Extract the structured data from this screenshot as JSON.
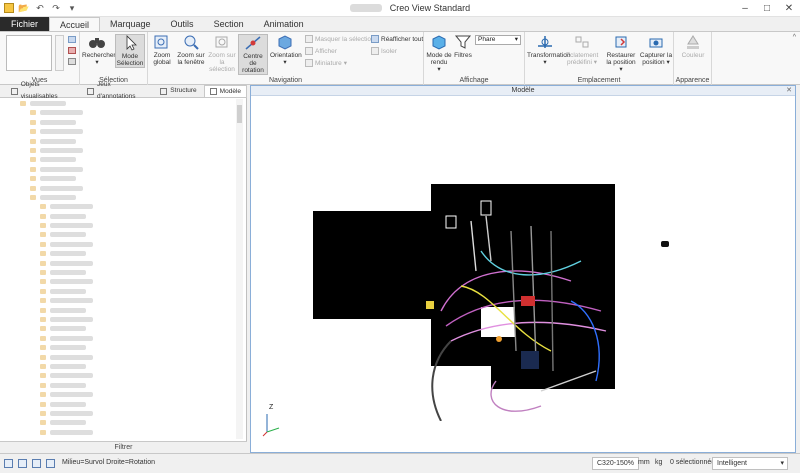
{
  "window": {
    "title": "Creo View Standard",
    "file_name": ""
  },
  "quick_access": [
    "app-icon",
    "open-icon",
    "undo-icon",
    "redo-icon",
    "dropdown-icon"
  ],
  "tabs": [
    {
      "label": "Fichier"
    },
    {
      "label": "Accueil"
    },
    {
      "label": "Marquage"
    },
    {
      "label": "Outils"
    },
    {
      "label": "Section"
    },
    {
      "label": "Animation"
    }
  ],
  "ribbon": {
    "groups": {
      "vues": "Vues",
      "selection": "Sélection",
      "navigation": "Navigation",
      "affichage": "Affichage",
      "emplacement": "Emplacement",
      "apparence": "Apparence"
    },
    "buttons": {
      "rechercher": "Rechercher",
      "mode_selection": "Mode Sélection",
      "zoom_global": "Zoom global",
      "zoom_fenetre": "Zoom sur la fenêtre",
      "zoom_selection": "Zoom sur la sélection",
      "centre_rotation": "Centre de rotation",
      "orientation": "Orientation",
      "masquer_selection": "Masquer la sélection",
      "afficher": "Afficher",
      "miniature": "Miniature",
      "reafficher_tout": "Réafficher tout",
      "isoler": "Isoler",
      "mode_rendu": "Mode de rendu",
      "filtres": "Filtres",
      "phare": "Phare",
      "transformation": "Transformation",
      "eclatement": "Eclatement prédéfini",
      "restaurer_position": "Restaurer la position",
      "capturer_position": "Capturer la position",
      "couleur": "Couleur"
    }
  },
  "panel": {
    "tabs": [
      {
        "label": "Objets visualisables"
      },
      {
        "label": "Jeux d'annotations"
      },
      {
        "label": "Structure"
      },
      {
        "label": "Modèle"
      }
    ],
    "filter_label": "Filtrer"
  },
  "viewport": {
    "title": "Modèle",
    "axis_z": "Z"
  },
  "status": {
    "mouse_hint": "Milieu=Survol  Droite=Rotation",
    "zoom": "C320-150%",
    "unit_length": "mm",
    "unit_mass": "kg",
    "selected": "0 sélectionné(s)",
    "mode": "Intelligent"
  },
  "colors": {
    "accent": "#2a6ab0",
    "file_tab": "#2a2a2a",
    "viewport_border": "#8aaed8"
  }
}
